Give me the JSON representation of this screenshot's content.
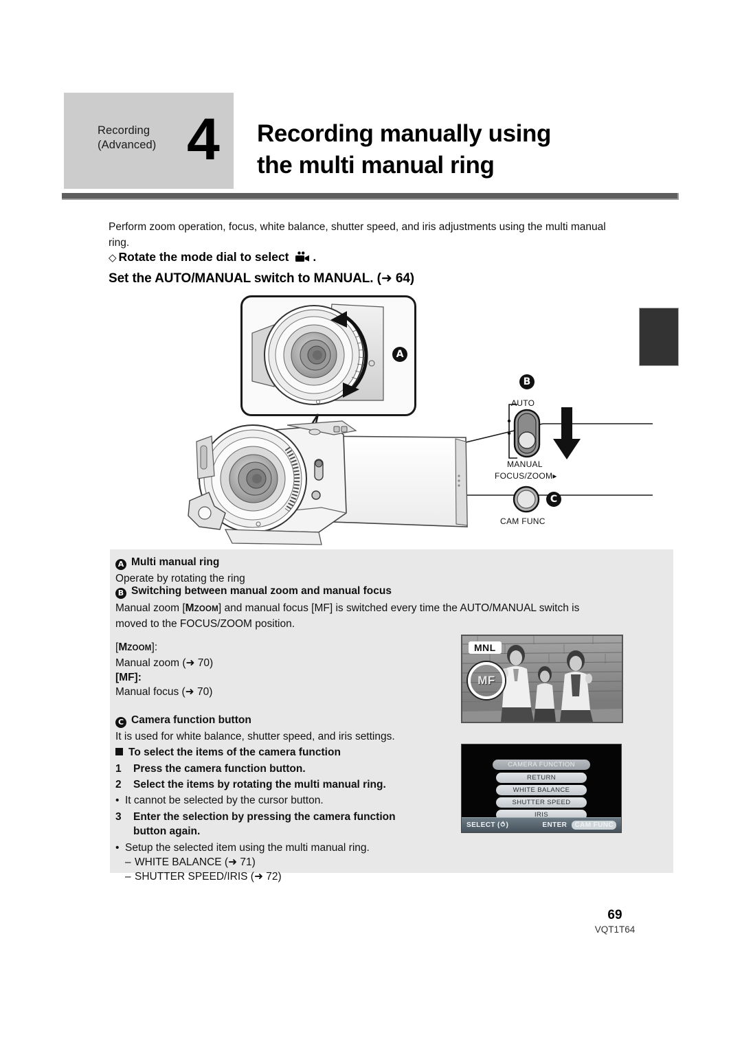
{
  "header": {
    "category_line1": "Recording",
    "category_line2": "(Advanced)",
    "chapter_number": "4",
    "title_line1": "Recording manually using",
    "title_line2": "the multi manual ring"
  },
  "intro": {
    "paragraph": "Perform zoom operation, focus, white balance, shutter speed, and iris adjustments using the multi manual ring.",
    "diamond_step": "Rotate the mode dial to select",
    "diamond_step_suffix": ".",
    "bold_step": "Set the AUTO/MANUAL switch to MANUAL. (➜ 64)"
  },
  "illustration": {
    "callout_a": "A",
    "callout_b": "B",
    "callout_c": "C",
    "switch_auto": "AUTO",
    "switch_manual": "MANUAL",
    "switch_focus_zoom": "FOCUS/ZOOM▸",
    "cam_func_label": "CAM FUNC"
  },
  "content": {
    "a_mark": "A",
    "a_heading": "Multi manual ring",
    "a_body": "Operate by rotating the ring",
    "b_mark": "B",
    "b_heading": "Switching between manual zoom and manual focus",
    "b_body_pre": "Manual zoom [",
    "b_body_mzoom_m": "M",
    "b_body_mzoom_z": "ZOOM",
    "b_body_mid": "] and manual focus [MF] is switched every time the AUTO/MANUAL switch is",
    "b_body_line2": "moved to the FOCUS/ZOOM position.",
    "mzoom_label_pre": "[",
    "mzoom_label_m": "M",
    "mzoom_label_z": "ZOOM",
    "mzoom_label_post": "]:",
    "mzoom_desc": "Manual zoom (➜ 70)",
    "mf_label": "[MF]:",
    "mf_desc": "Manual focus (➜ 70)",
    "c_mark": "C",
    "c_heading": "Camera function button",
    "c_body": "It is used for white balance, shutter speed, and iris settings.",
    "c_sub_heading": "To select the items of the camera function",
    "step1_num": "1",
    "step1": "Press the camera function button.",
    "step2_num": "2",
    "step2": "Select the items by rotating the multi manual ring.",
    "note1": "It cannot be selected by the cursor button.",
    "step3_num": "3",
    "step3_line1": "Enter the selection by pressing the camera function",
    "step3_line2": "button again.",
    "note2": "Setup the selected item using the multi manual ring.",
    "sub1": "WHITE BALANCE (➜ 71)",
    "sub2": "SHUTTER SPEED/IRIS (➜ 72)"
  },
  "photo": {
    "mnl_badge": "MNL",
    "mf_indicator": "MF"
  },
  "lcd_menu": {
    "title": "CAMERA FUNCTION",
    "items": [
      "RETURN",
      "WHITE BALANCE",
      "SHUTTER SPEED",
      "IRIS"
    ],
    "select_label": "SELECT (⥀)",
    "enter_label": "ENTER",
    "enter_button": "CAM FUNC"
  },
  "footer": {
    "page_number": "69",
    "doc_code": "VQT1T64"
  },
  "colors": {
    "header_box": "#cccccc",
    "rule": "#5e5e5e",
    "content_box": "#e8e8e8",
    "thumb_tab": "#333333"
  }
}
